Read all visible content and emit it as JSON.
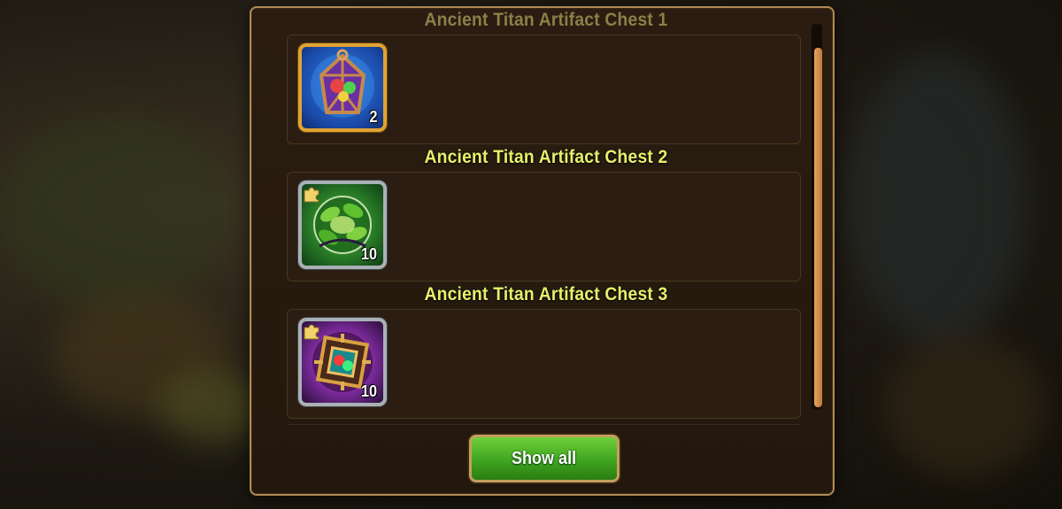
{
  "dialog": {
    "chests": [
      {
        "title": "Ancient Titan Artifact Chest 1",
        "reward": {
          "icon": "lantern-artifact-icon",
          "quantity": "2",
          "frame": "gold"
        }
      },
      {
        "title": "Ancient Titan Artifact Chest 2",
        "reward": {
          "icon": "leaf-fragment-icon",
          "quantity": "10",
          "frame": "silver"
        }
      },
      {
        "title": "Ancient Titan Artifact Chest 3",
        "reward": {
          "icon": "amulet-fragment-icon",
          "quantity": "10",
          "frame": "silver"
        }
      }
    ],
    "show_all_label": "Show all"
  },
  "colors": {
    "title_text": "#e6f06a",
    "panel_border": "#b08a55",
    "button_green": "#3fa51f",
    "scroll_thumb": "#e3a35c"
  }
}
